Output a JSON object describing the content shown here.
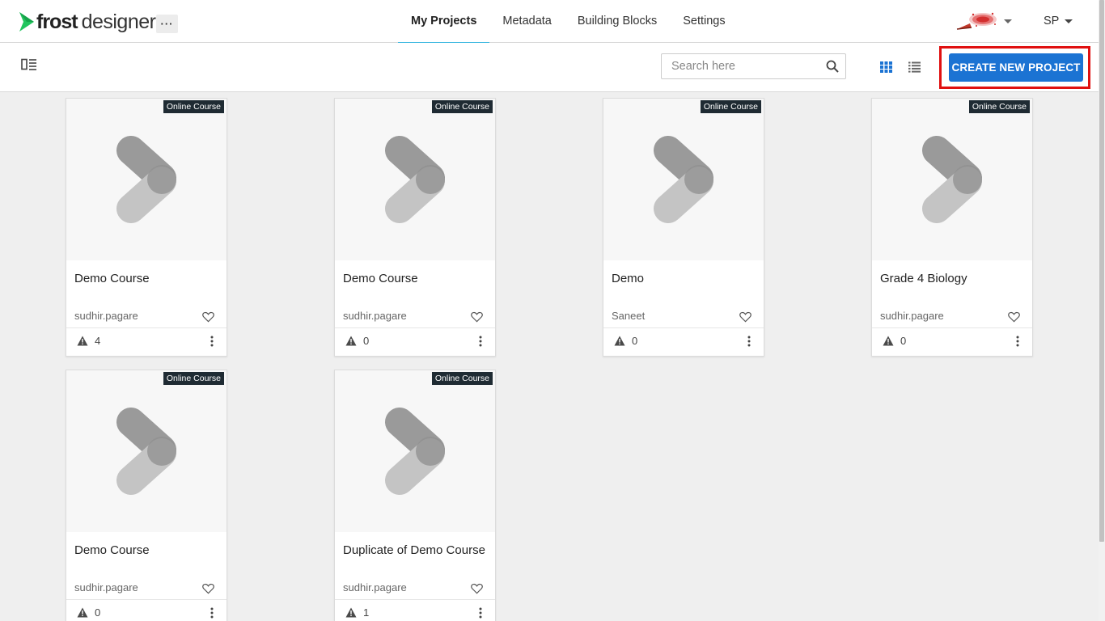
{
  "app": {
    "logo_bold": "frost",
    "logo_light": "designer",
    "more_label": "···"
  },
  "nav": {
    "items": [
      {
        "label": "My Projects",
        "active": true
      },
      {
        "label": "Metadata",
        "active": false
      },
      {
        "label": "Building Blocks",
        "active": false
      },
      {
        "label": "Settings",
        "active": false
      }
    ]
  },
  "user": {
    "initials": "SP"
  },
  "toolbar": {
    "search_placeholder": "Search here",
    "search_value": "",
    "create_label": "CREATE NEW PROJECT",
    "view_mode": "grid"
  },
  "colors": {
    "accent": "#1b73d3",
    "nav_underline": "#3bb8e0",
    "highlight": "#e01010",
    "badge_bg": "#1f2b33"
  },
  "projects": [
    {
      "title": "Demo Course",
      "author": "sudhir.pagare",
      "badge": "Online Course",
      "warnings": "4"
    },
    {
      "title": "Demo Course",
      "author": "sudhir.pagare",
      "badge": "Online Course",
      "warnings": "0"
    },
    {
      "title": "Demo",
      "author": "Saneet",
      "badge": "Online Course",
      "warnings": "0"
    },
    {
      "title": "Grade 4 Biology",
      "author": "sudhir.pagare",
      "badge": "Online Course",
      "warnings": "0"
    },
    {
      "title": "Demo Course",
      "author": "sudhir.pagare",
      "badge": "Online Course",
      "warnings": "0"
    },
    {
      "title": "Duplicate of Demo Course",
      "author": "sudhir.pagare",
      "badge": "Online Course",
      "warnings": "1"
    }
  ]
}
